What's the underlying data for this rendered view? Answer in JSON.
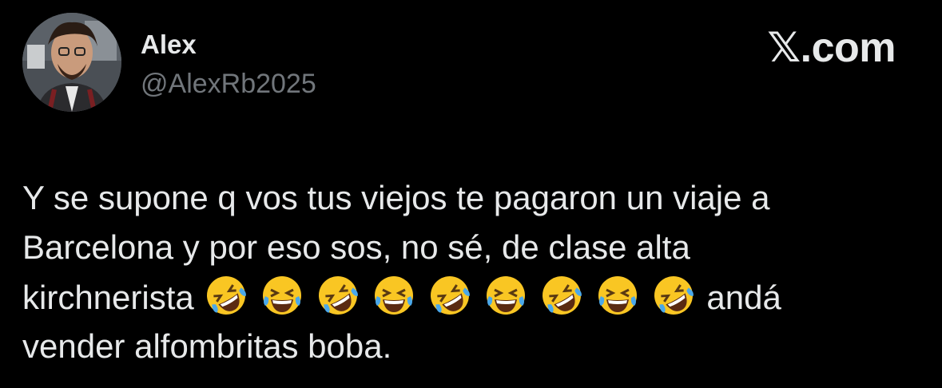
{
  "author": {
    "name": "Alex",
    "handle": "@AlexRb2025"
  },
  "brand": {
    "label": "𝕏.com"
  },
  "tweet": {
    "line1": "Y se supone q vos tus viejos te pagaron un viaje a",
    "line2": "Barcelona y por eso sos, no sé, de clase alta",
    "line3_text": "kirchnerista",
    "emojis": [
      "🤣",
      "😂",
      "🤣",
      "😂",
      "🤣",
      "😂",
      "🤣",
      "😂",
      "🤣"
    ],
    "emoji_names": [
      "rolling-on-floor-laughing",
      "face-with-tears-of-joy",
      "rolling-on-floor-laughing",
      "face-with-tears-of-joy",
      "rolling-on-floor-laughing",
      "face-with-tears-of-joy",
      "rolling-on-floor-laughing",
      "face-with-tears-of-joy",
      "rolling-on-floor-laughing"
    ],
    "line3_after": "andá",
    "line4": "vender alfombritas boba."
  },
  "colors": {
    "background": "#000000",
    "text": "#e7e9ea",
    "secondary_text": "#71767b",
    "emoji_yellow": "#f9c623",
    "emoji_tear": "#4aa8ea"
  }
}
